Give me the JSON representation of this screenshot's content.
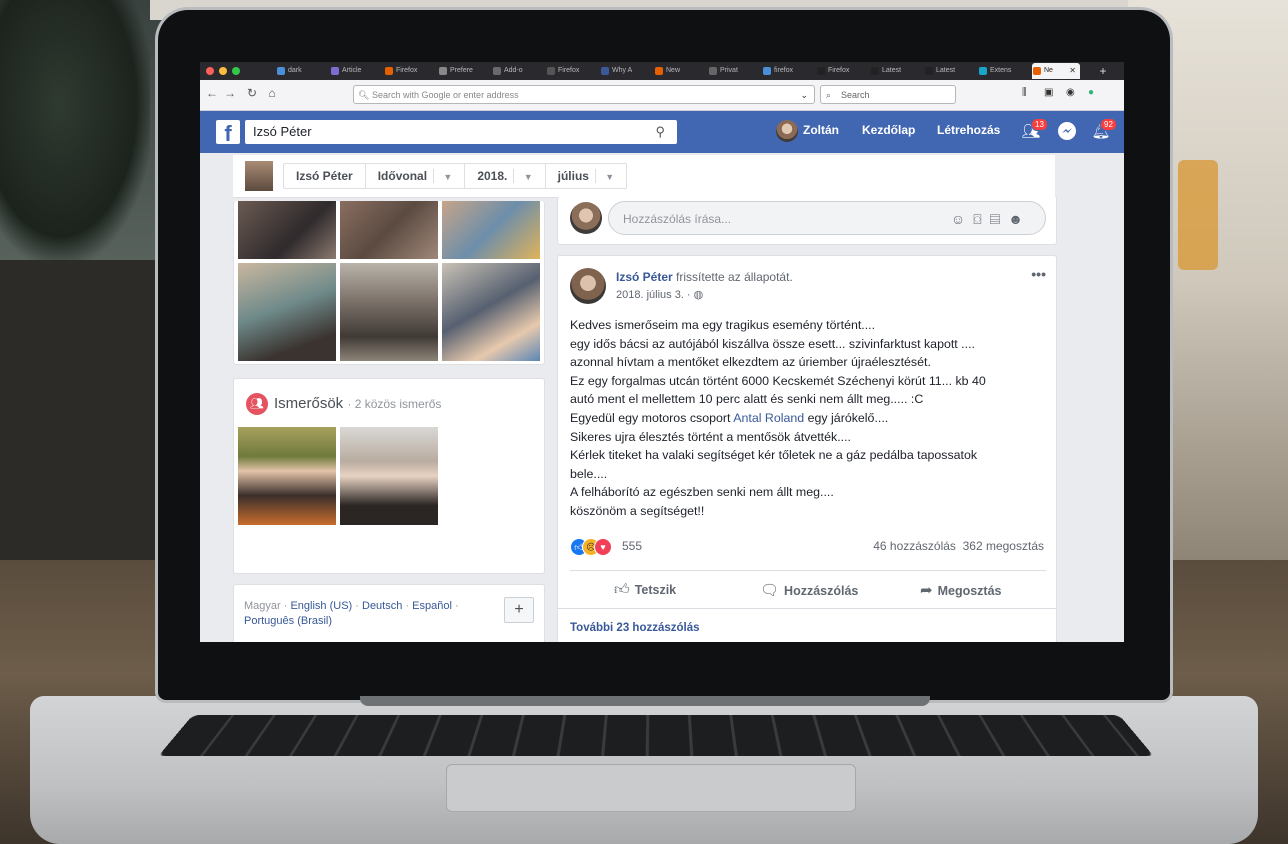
{
  "browser": {
    "tabs": [
      {
        "label": "dark",
        "color": "#4a90d9"
      },
      {
        "label": "Article",
        "color": "#7a6fd0"
      },
      {
        "label": "Firefox",
        "color": "#e66000"
      },
      {
        "label": "Prefere",
        "color": "#888888"
      },
      {
        "label": "Add-o",
        "color": "#6a6a6a"
      },
      {
        "label": "Firefox",
        "color": "#555555"
      },
      {
        "label": "Why A",
        "color": "#3b5998"
      },
      {
        "label": "New",
        "color": "#e66000"
      },
      {
        "label": "Privat",
        "color": "#666666"
      },
      {
        "label": "firefox",
        "color": "#4a90d9"
      },
      {
        "label": "Firefox",
        "color": "#222222"
      },
      {
        "label": "Latest",
        "color": "#222222"
      },
      {
        "label": "Latest",
        "color": "#222222"
      },
      {
        "label": "Extens",
        "color": "#18a6c9"
      },
      {
        "label": "Ne",
        "color": "#e66000"
      }
    ],
    "close_tab": "✕",
    "new_tab": "+",
    "url_placeholder": "Search with Google or enter address",
    "search_placeholder": "Search"
  },
  "facebook": {
    "search_value": "Izsó Péter",
    "user_name": "Zoltán",
    "nav_home": "Kezdőlap",
    "nav_create": "Létrehozás",
    "friend_requests_badge": "13",
    "notifications_badge": "92"
  },
  "timeline": {
    "crumbs": [
      "Izsó Péter",
      "Idővonal",
      "2018.",
      "július"
    ]
  },
  "friends": {
    "title": "Ismerősök",
    "subtitle": "· 2 közös ismerős"
  },
  "languages": {
    "current": "Magyar",
    "others": [
      "English (US)",
      "Deutsch",
      "Español",
      "Português (Brasil)"
    ],
    "plus": "+"
  },
  "composer": {
    "placeholder": "Hozzászólás írása..."
  },
  "post": {
    "author": "Izsó Péter",
    "action": "frissítette az állapotát.",
    "date": "2018. július 3. ·",
    "more": "•••",
    "lines": [
      "Kedves ismerőseim ma egy tragikus esemény történt....",
      "egy idős bácsi az autójából kiszállva össze esett... szivinfarktust kapott ....",
      "azonnal hívtam a mentőket elkezdtem az úriember újraélesztését.",
      "Ez egy forgalmas utcán történt 6000 Kecskemét Széchenyi körút 11... kb 40",
      "autó ment el mellettem 10 perc alatt és senki nem állt meg..... :C"
    ],
    "line6_before": "Egyedül egy motoros csoport ",
    "line6_link": "Antal Roland",
    "line6_after": " egy járókelő....",
    "lines_after": [
      "Sikeres ujra élesztés történt a mentősök átvették....",
      "Kérlek titeket ha valaki segítséget kér tőletek ne a gáz pedálba tapossatok",
      "bele....",
      "A felháborító az egészben senki nem állt meg....",
      "köszönöm a segítséget!!"
    ],
    "reaction_count": "555",
    "comments": "46 hozzászólás",
    "shares": "362 megosztás",
    "like_label": "Tetszik",
    "comment_label": "Hozzászólás",
    "share_label": "Megosztás",
    "more_comments": "További 23 hozzászólás"
  }
}
